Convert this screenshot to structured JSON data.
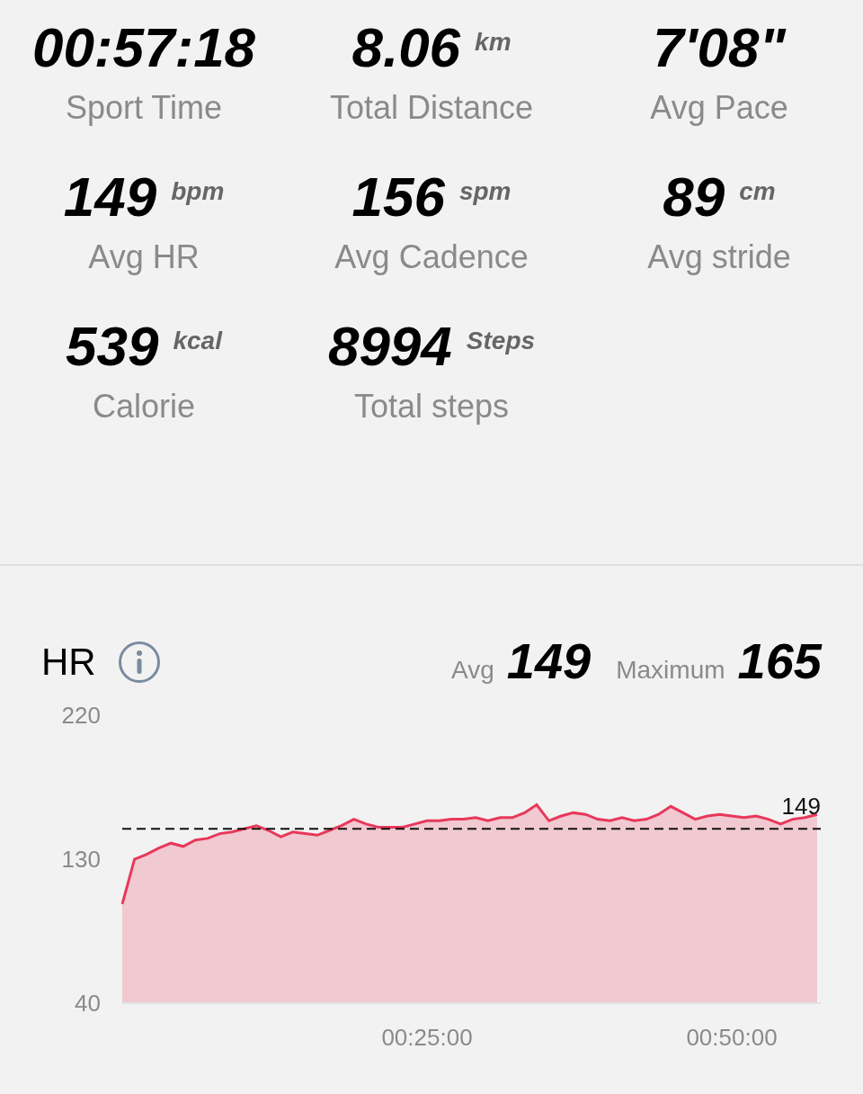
{
  "stats": [
    {
      "value": "00:57:18",
      "label": "Sport Time"
    },
    {
      "value": "8.06",
      "unit": "km",
      "label": "Total Distance"
    },
    {
      "value": "7'08\"",
      "label": "Avg Pace"
    },
    {
      "value": "149",
      "unit": "bpm",
      "label": "Avg HR"
    },
    {
      "value": "156",
      "unit": "spm",
      "label": "Avg Cadence"
    },
    {
      "value": "89",
      "unit": "cm",
      "label": "Avg stride"
    },
    {
      "value": "539",
      "unit": "kcal",
      "label": "Calorie"
    },
    {
      "value": "8994",
      "unit": "Steps",
      "label": "Total steps"
    }
  ],
  "hr": {
    "title": "HR",
    "avg_label": "Avg",
    "avg": "149",
    "max_label": "Maximum",
    "max": "165",
    "chart_data": {
      "type": "area",
      "xlim": [
        0,
        57.3
      ],
      "ylim": [
        40,
        220
      ],
      "yticks": [
        40,
        130,
        220
      ],
      "xticks": [
        {
          "value": 25,
          "label": "00:25:00"
        },
        {
          "value": 50,
          "label": "00:50:00"
        }
      ],
      "x": [
        0,
        1,
        2,
        3,
        4,
        5,
        6,
        7,
        8,
        9,
        10,
        11,
        12,
        13,
        14,
        15,
        16,
        17,
        18,
        19,
        20,
        21,
        22,
        23,
        24,
        25,
        26,
        27,
        28,
        29,
        30,
        31,
        32,
        33,
        34,
        35,
        36,
        37,
        38,
        39,
        40,
        41,
        42,
        43,
        44,
        45,
        46,
        47,
        48,
        49,
        50,
        51,
        52,
        53,
        54,
        55,
        56,
        57
      ],
      "series": [
        {
          "color": "#e8385a",
          "values": [
            102,
            130,
            133,
            137,
            140,
            138,
            142,
            143,
            146,
            147,
            149,
            151,
            148,
            144,
            147,
            146,
            145,
            148,
            151,
            155,
            152,
            150,
            150,
            150,
            152,
            154,
            154,
            155,
            155,
            156,
            154,
            156,
            156,
            159,
            164,
            154,
            157,
            159,
            158,
            155,
            154,
            156,
            154,
            155,
            158,
            163,
            159,
            155,
            157,
            158,
            157,
            156,
            157,
            155,
            152,
            155,
            156,
            158
          ]
        }
      ],
      "ref_lines": [
        {
          "axis": "y",
          "value": 149,
          "label": "149"
        }
      ]
    }
  }
}
